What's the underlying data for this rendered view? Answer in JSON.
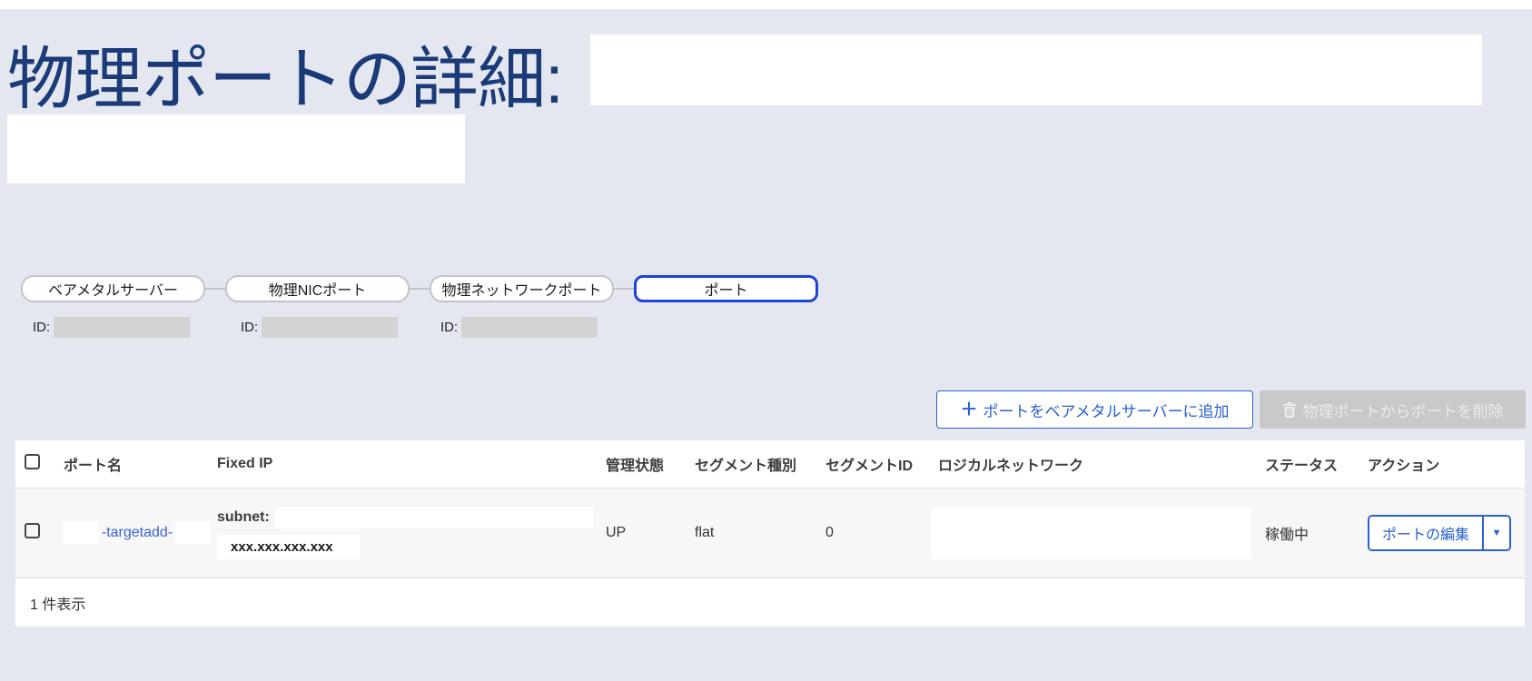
{
  "page": {
    "title": "物理ポートの詳細:"
  },
  "chain": {
    "nodes": [
      {
        "label": "ベアメタルサーバー",
        "id_label": "ID:"
      },
      {
        "label": "物理NICポート",
        "id_label": "ID:"
      },
      {
        "label": "物理ネットワークポート",
        "id_label": "ID:"
      },
      {
        "label": "ポート"
      }
    ]
  },
  "toolbar": {
    "plus_glyph": "＋",
    "add_button_label": "ポートをベアメタルサーバーに追加",
    "delete_button_label": "物理ポートからポートを削除",
    "delete_button_icon": "trash-icon",
    "caret_glyph": "▼"
  },
  "table": {
    "columns": [
      "ポート名",
      "Fixed IP",
      "管理状態",
      "セグメント種別",
      "セグメントID",
      "ロジカルネットワーク",
      "ステータス",
      "アクション"
    ],
    "row": {
      "port_name": "-targetadd-",
      "subnet_label": "subnet:",
      "ip_masked": "xxx.xxx.xxx.xxx",
      "admin_state": "UP",
      "segment_type": "flat",
      "segment_id": "0",
      "status": "稼働中",
      "edit_button_label": "ポートの編集"
    },
    "footer_text": "1 件表示"
  },
  "colors": {
    "page_bg": "#e4e7f0",
    "title_navy": "#1a3a78",
    "accent_blue": "#2760d3",
    "active_node_border": "#1e43d8",
    "link_blue": "#3763e3",
    "disabled_gray": "#c9c9c9"
  }
}
